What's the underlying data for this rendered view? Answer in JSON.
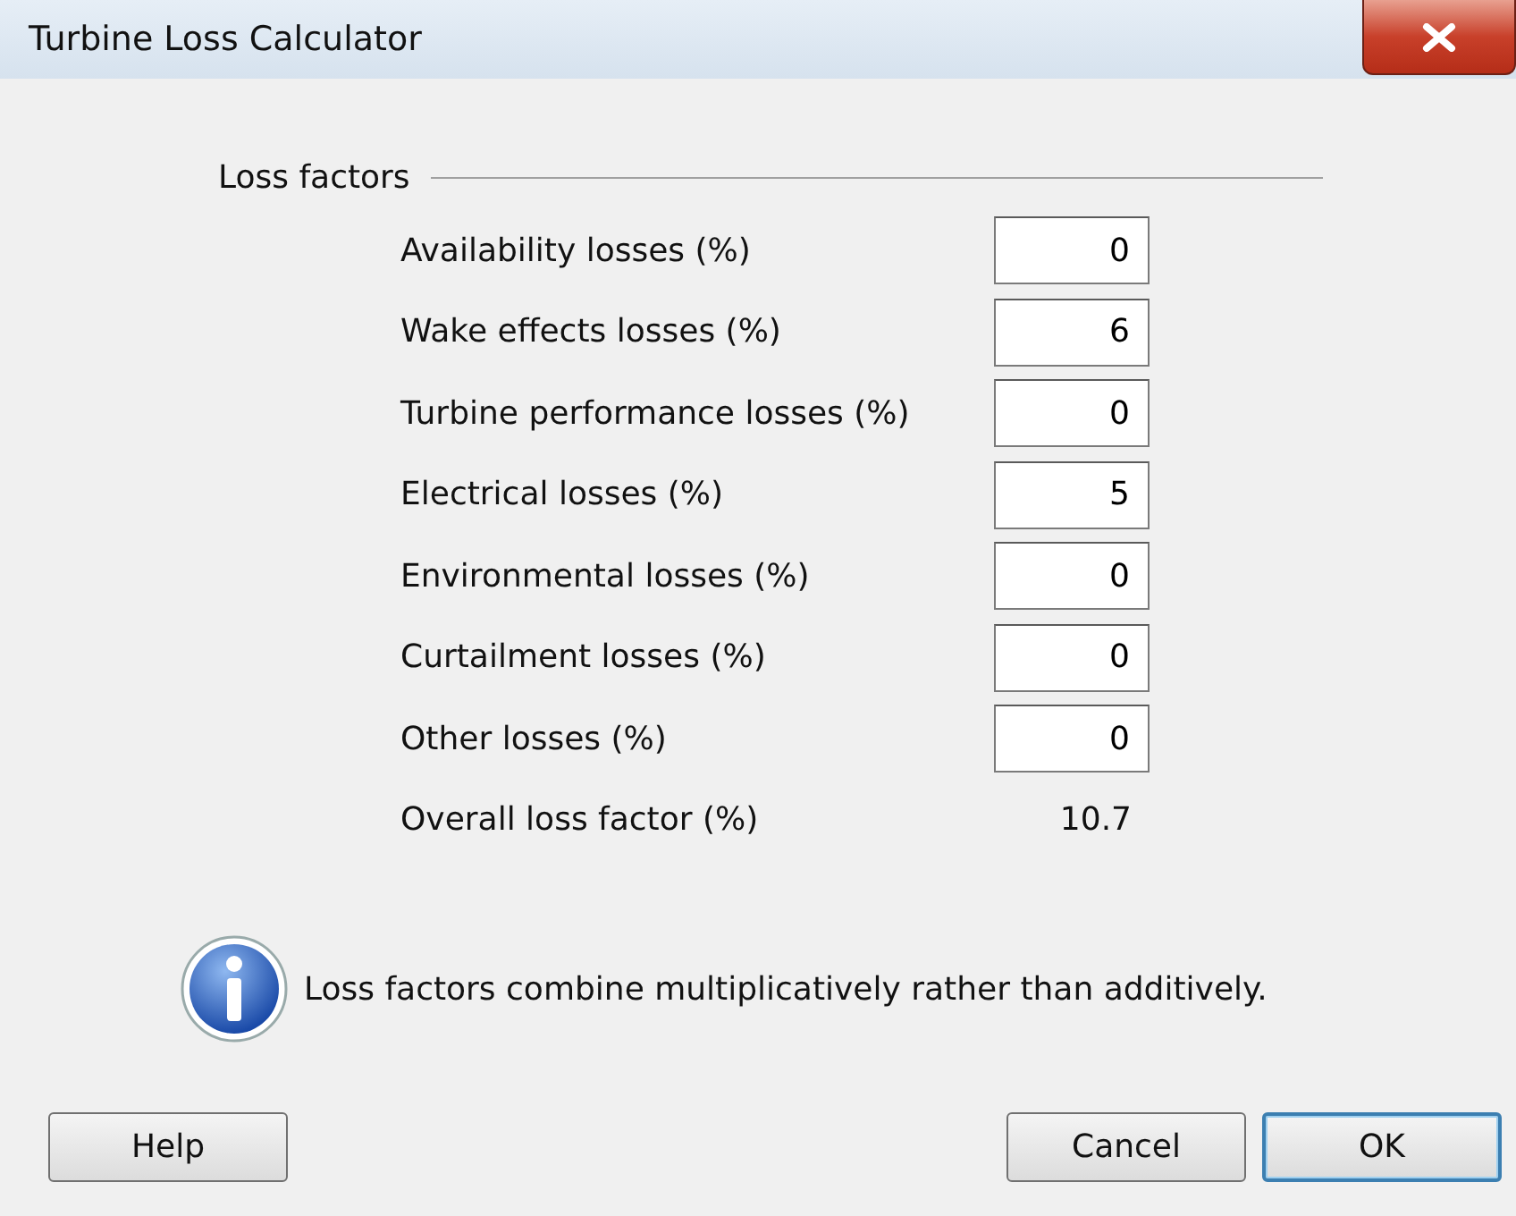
{
  "window": {
    "title": "Turbine Loss Calculator"
  },
  "group": {
    "label": "Loss factors"
  },
  "fields": [
    {
      "label": "Availability losses (%)",
      "value": "0"
    },
    {
      "label": "Wake effects losses (%)",
      "value": "6"
    },
    {
      "label": "Turbine performance losses (%)",
      "value": "0"
    },
    {
      "label": "Electrical losses (%)",
      "value": "5"
    },
    {
      "label": "Environmental losses (%)",
      "value": "0"
    },
    {
      "label": "Curtailment losses (%)",
      "value": "0"
    },
    {
      "label": "Other losses (%)",
      "value": "0"
    }
  ],
  "overall": {
    "label": "Overall loss factor (%)",
    "value": "10.7"
  },
  "note": "Loss factors combine multiplicatively rather than additively.",
  "buttons": [
    {
      "label": "Help",
      "default": false
    },
    {
      "label": "Cancel",
      "default": false
    },
    {
      "label": "OK",
      "default": true
    }
  ]
}
